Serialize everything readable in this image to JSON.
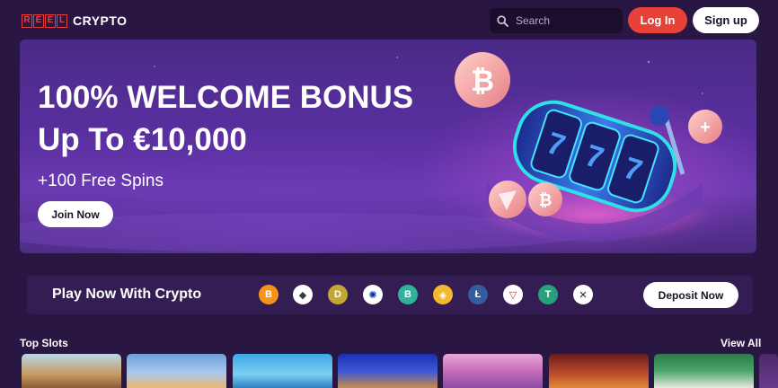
{
  "header": {
    "logo_reel_letters": [
      "R",
      "E",
      "E",
      "L"
    ],
    "logo_crypto": "CRYPTO",
    "search_placeholder": "Search",
    "login_label": "Log In",
    "signup_label": "Sign up"
  },
  "hero": {
    "title_line1": "100% WELCOME BONUS",
    "title_line2": "Up To €10,000",
    "subtitle": "+100 Free Spins",
    "join_label": "Join Now"
  },
  "crypto_bar": {
    "title": "Play Now With Crypto",
    "deposit_label": "Deposit Now",
    "coins": [
      {
        "icon": "bitcoin-icon",
        "glyph": "B",
        "color": "#f7931a"
      },
      {
        "icon": "ethereum-icon",
        "glyph": "◆",
        "color": "#ffffff"
      },
      {
        "icon": "dogecoin-icon",
        "glyph": "D",
        "color": "#c3a634"
      },
      {
        "icon": "cardano-icon",
        "glyph": "✺",
        "color": "#ffffff"
      },
      {
        "icon": "bitcoin-cash-icon",
        "glyph": "B",
        "color": "#2fb39a"
      },
      {
        "icon": "binance-icon",
        "glyph": "◈",
        "color": "#f3ba2f"
      },
      {
        "icon": "litecoin-icon",
        "glyph": "Ł",
        "color": "#345d9d"
      },
      {
        "icon": "tron-icon",
        "glyph": "▽",
        "color": "#ffffff"
      },
      {
        "icon": "tether-icon",
        "glyph": "T",
        "color": "#26a17b"
      },
      {
        "icon": "ripple-icon",
        "glyph": "✕",
        "color": "#ffffff"
      }
    ]
  },
  "top_slots": {
    "heading": "Top Slots",
    "view_all_label": "View All"
  },
  "colors": {
    "background": "#2a1642",
    "accent_red": "#e8413a",
    "crypto_bar_bg": "#341d52",
    "search_bg": "#1b0d2c"
  }
}
